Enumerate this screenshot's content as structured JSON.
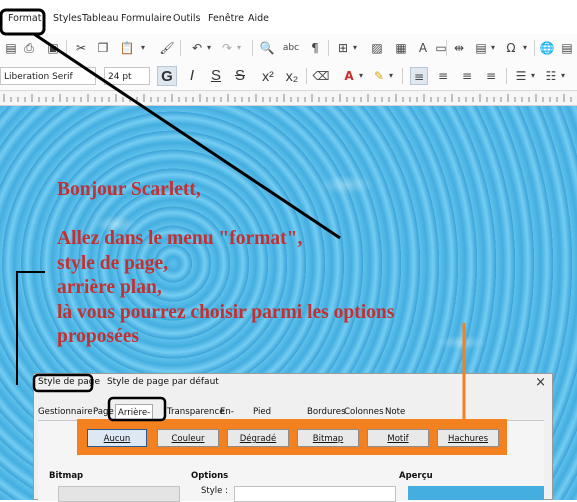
{
  "menubar": {
    "items": [
      "Format",
      "Styles",
      "Tableau",
      "Formulaire",
      "Outils",
      "Fenêtre",
      "Aide"
    ]
  },
  "toolbar": {
    "font_name": "Liberation Serif",
    "font_size": "24 pt",
    "format_buttons": [
      "G",
      "I",
      "S",
      "S",
      "x²",
      "x₂"
    ]
  },
  "document": {
    "lines": [
      "Bonjour Scarlett,",
      "",
      "Allez dans le menu \"format\",",
      "style de page,",
      "arrière plan,",
      "là vous pourrez choisir parmi les options",
      "proposées"
    ],
    "text_color": "#c62f2f"
  },
  "dialog": {
    "title_label": "Style de page",
    "title_value": "Style de page par défaut",
    "close_glyph": "×",
    "tabs": [
      "Gestionnaire",
      "Page",
      "Arrière-plan",
      "Transparence",
      "En-tête",
      "Pied de page",
      "Bordures",
      "Colonnes",
      "Note de bas de page"
    ],
    "active_tab": "Arrière-plan",
    "options": [
      "Aucun",
      "Couleur",
      "Dégradé",
      "Bitmap",
      "Motif",
      "Hachures"
    ],
    "sections": {
      "bitmap": "Bitmap",
      "options": "Options",
      "style_label": "Style :",
      "apercu": "Aperçu"
    }
  },
  "annotation_colors": {
    "highlight": "#000000",
    "orange": "#f48120"
  }
}
